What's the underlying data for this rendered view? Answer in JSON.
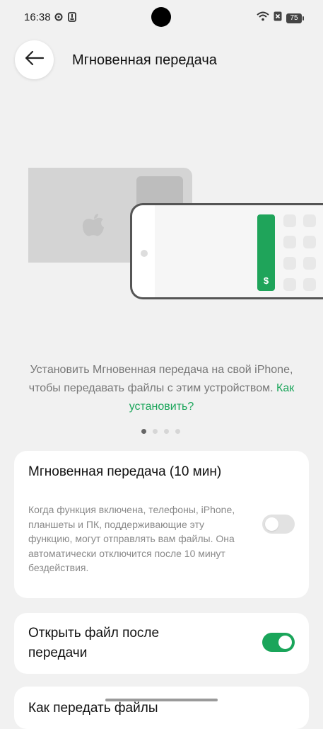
{
  "status_bar": {
    "time": "16:38",
    "battery": "75"
  },
  "header": {
    "title": "Мгновенная передача"
  },
  "description": {
    "text": "Установить Мгновенная передача на свой iPhone, чтобы передавать файлы с этим устройством.",
    "link": "Как установить?"
  },
  "pager": {
    "count": 4,
    "active": 0
  },
  "settings": {
    "instant_transfer": {
      "title": "Мгновенная передача (10 мин)",
      "description": "Когда функция включена, телефоны, iPhone, планшеты и ПК, поддерживающие эту функцию, могут отправлять вам файлы. Она автоматически отключится после 10 минут бездействия.",
      "enabled": false
    },
    "open_after_transfer": {
      "title": "Открыть файл после передачи",
      "enabled": true
    },
    "how_to_transfer": {
      "title": "Как передать файлы"
    }
  },
  "colors": {
    "accent": "#1aa55a",
    "background": "#f1f1f1"
  }
}
